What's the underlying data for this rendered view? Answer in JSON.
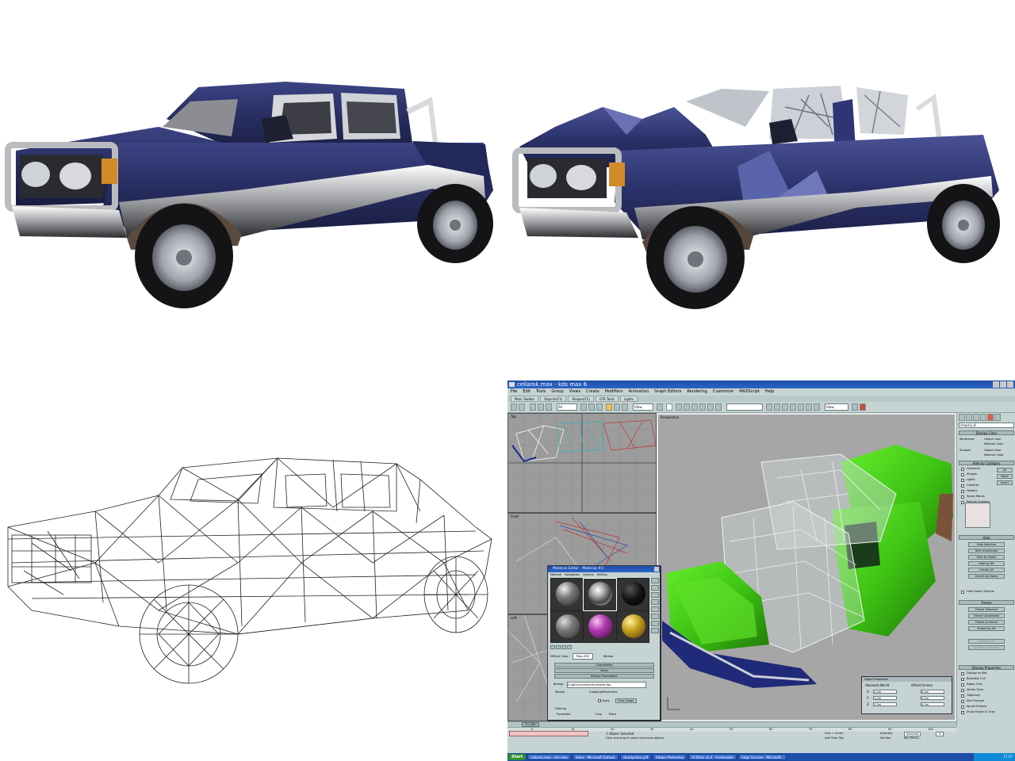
{
  "app": {
    "title": "cellarok.max - kds max 6",
    "menu": [
      "File",
      "Edit",
      "Tools",
      "Group",
      "Views",
      "Create",
      "Modifiers",
      "Animation",
      "Graph Editors",
      "Rendering",
      "Customize",
      "MAXScript",
      "Help"
    ],
    "tabs": [
      "Main Toolbar",
      "Objects(F1)",
      "Shapes(F2)",
      "GTA Tools",
      "Lights"
    ],
    "toolbar": {
      "filter_value": "All",
      "view_value": "View",
      "view_value2": "View"
    },
    "viewports": {
      "top": "Top",
      "front": "Front",
      "left": "Left",
      "perspective": "Perspective"
    },
    "command_panel": {
      "object_name": "chassis_hi",
      "rollouts": [
        "Display Color",
        "Hide by Category",
        "Hide",
        "Freeze",
        "Display Properties"
      ],
      "display_color": {
        "wireframe_label": "Wireframe:",
        "shaded_label": "Shaded:",
        "object_color": "Object Color",
        "material_color": "Material Color"
      },
      "hide_category_items": [
        "Geometry",
        "Shapes",
        "Lights",
        "Cameras",
        "Helpers",
        "Space Warps",
        "Particle Systems"
      ],
      "hide_category_buttons": [
        "All",
        "None",
        "Invert"
      ],
      "hide_buttons": [
        "Hide Selected",
        "Hide Unselected",
        "Hide by Name",
        "Hide by Hit",
        "Unhide All",
        "Unhide by Name"
      ],
      "hide_check": "Hide Frozen Objects",
      "freeze_buttons": [
        "Freeze Selected",
        "Freeze Unselected",
        "Freeze by Name",
        "Freeze by Hit",
        "Unfreeze All",
        "Unfreeze by Name"
      ],
      "display_props": [
        "Display as Box",
        "Backface Cull",
        "Edges Only",
        "Vertex Ticks",
        "Trajectory",
        "See-Through",
        "Ignore Extents",
        "Show Frozen in Gray"
      ]
    },
    "material_editor": {
      "title": "Material Editor - Material #3",
      "menu": [
        "Material",
        "Navigation",
        "Options",
        "Utilities"
      ],
      "diffuse_label": "Diffuse Color:",
      "map_value": "Map #58",
      "bitmap_label": "Bitmap",
      "rollouts": [
        "Coordinates",
        "Noise",
        "Bitmap Parameters"
      ],
      "bitmap_path": "G:\\gtl\\cars\\cellarok\\cellarok.tga",
      "cropping_label": "Cropping/Placement",
      "reload_label": "Reload",
      "apply_label": "Apply",
      "view_image_label": "View Image",
      "filtering_label": "Filtering",
      "filtering_options": [
        "Pyramidal",
        "Crop",
        "Place"
      ]
    },
    "dialog": {
      "title": "Object Properties",
      "col1": "Absolute:World",
      "col2": "Offset:Screen",
      "fields": [
        "X",
        "Y",
        "Z"
      ],
      "values1": [
        "1.0m",
        "1.0m",
        "1.0m"
      ],
      "values2": [
        "0.0m",
        "0.0m",
        "0.0m"
      ]
    },
    "status": {
      "frame": "0 / 100",
      "selection": "1 Object Selected",
      "prompt": "Click and drag to select and move objects",
      "grid": "Grid = 10.0m",
      "add_time_tag": "Add Time Tag",
      "auto_key": "Auto Key",
      "set_key": "Set Key",
      "key_filters": "Key Filters...",
      "selected": "Selected",
      "frame_field": "0",
      "ticks": [
        "0",
        "10",
        "20",
        "30",
        "40",
        "50",
        "60",
        "70",
        "80",
        "90",
        "100"
      ]
    },
    "taskbar": {
      "start": "Start",
      "items": [
        "cellarok.max - kds max",
        "Inbox - Microsoft Outlook",
        "steadystate.pdf",
        "Adobe Photoshop",
        "ACDSee v4.0 - Acidmodels",
        "Edge Focuses - Microsoft..."
      ],
      "clock": "17:57"
    }
  },
  "colors": {
    "body": "#2a3168",
    "chrome": "#c8cacb",
    "window_blue": "#1e4ea8",
    "panel": "#c6d3d3",
    "green_body": "#3ec214",
    "viewport_bg": "#a6a6a6"
  }
}
